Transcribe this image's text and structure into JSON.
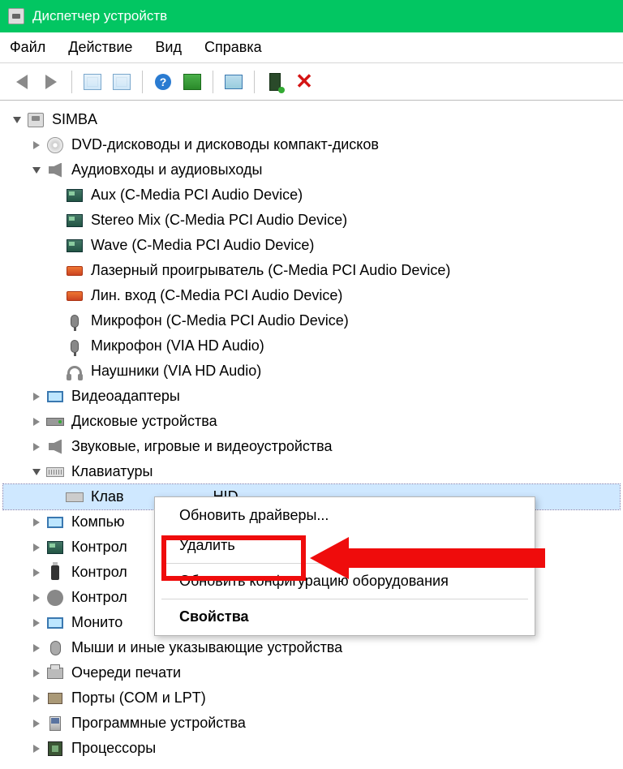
{
  "window": {
    "title": "Диспетчер устройств"
  },
  "menu": {
    "file": "Файл",
    "action": "Действие",
    "view": "Вид",
    "help": "Справка"
  },
  "tree": {
    "root": "SIMBA",
    "dvd": "DVD-дисководы и дисководы компакт-дисков",
    "audio": "Аудиовходы и аудиовыходы",
    "audio_children": [
      "Aux (C-Media PCI Audio Device)",
      "Stereo Mix (C-Media PCI Audio Device)",
      "Wave (C-Media PCI Audio Device)",
      "Лазерный проигрыватель (C-Media PCI Audio Device)",
      "Лин. вход (C-Media PCI Audio Device)",
      "Микрофон (C-Media PCI Audio Device)",
      "Микрофон (VIA HD Audio)",
      "Наушники (VIA HD Audio)"
    ],
    "video": "Видеоадаптеры",
    "disk": "Дисковые устройства",
    "svg": "Звуковые, игровые и видеоустройства",
    "keyboards": "Клавиатуры",
    "keyboard_item_prefix": "Клав",
    "keyboard_item_suffix": "HID",
    "computer": "Компью",
    "controllers1": "Контрол",
    "controllers2": "Контрол",
    "controllers3": "Контрол",
    "monitors": "Монито",
    "mice": "Мыши и иные указывающие устройства",
    "print": "Очереди печати",
    "ports": "Порты (COM и LPT)",
    "software": "Программные устройства",
    "cpu": "Процессоры"
  },
  "context_menu": {
    "update_drivers": "Обновить драйверы...",
    "delete": "Удалить",
    "scan_hw": "Обновить конфигурацию оборудования",
    "properties": "Свойства"
  }
}
